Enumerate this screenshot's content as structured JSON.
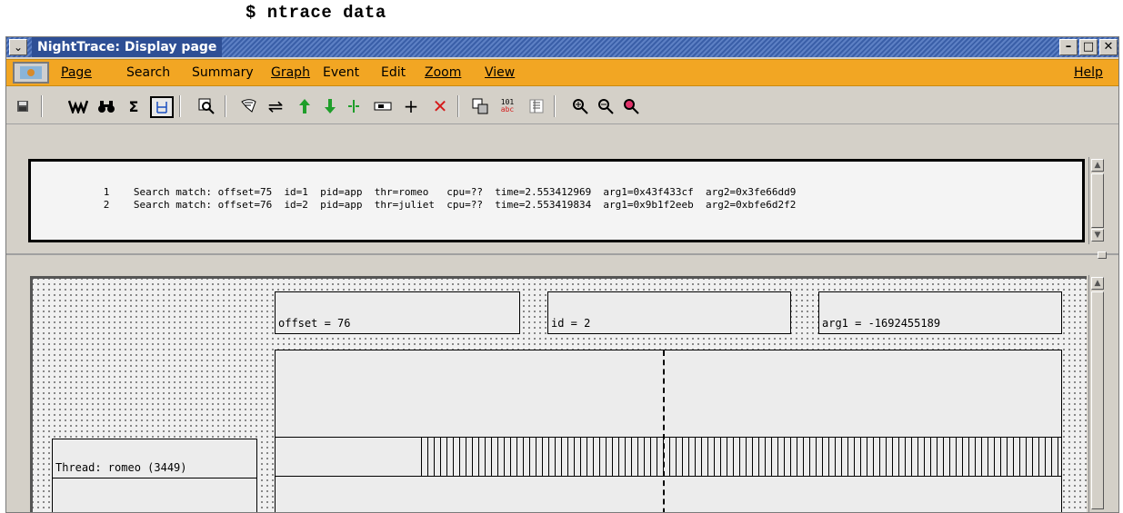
{
  "command": "$ ntrace data",
  "window": {
    "title": "NightTrace: Display page",
    "controls": {
      "minimize": "–",
      "maximize": "□",
      "close": "✕"
    }
  },
  "menu": {
    "items": [
      {
        "id": "page",
        "label": "Page"
      },
      {
        "id": "search",
        "label": "Search"
      },
      {
        "id": "summary",
        "label": "Summary"
      },
      {
        "id": "graph",
        "label": "Graph"
      },
      {
        "id": "event",
        "label": "Event"
      },
      {
        "id": "edit",
        "label": "Edit"
      },
      {
        "id": "zoom",
        "label": "Zoom"
      },
      {
        "id": "view",
        "label": "View"
      }
    ],
    "help": "Help"
  },
  "toolbar": {
    "icons": {
      "save": "save-icon",
      "filter": "filter-icon",
      "search": "binoculars-icon",
      "sigma": "Σ",
      "summary": "summary-icon",
      "inspect": "magnifier-icon",
      "edit": "edit-icon",
      "swap": "⇌",
      "up": "↑",
      "down": "↓",
      "split": "split-icon",
      "tag": "tag-icon",
      "cross": "+",
      "delete": "✕",
      "copy": "copy-icon",
      "binary": "binary-icon",
      "list": "list-icon",
      "zoom_in": "zoom-in-icon",
      "zoom_out": "zoom-out-icon",
      "zoom_reset": "zoom-reset-icon"
    },
    "sigma_text": "Σ",
    "binary_text_top": "101",
    "binary_text_bottom": "abc",
    "colors": {
      "green": "#1f9e2a",
      "red": "#d51a1a"
    }
  },
  "search_results": [
    {
      "index": "1",
      "text": "Search match: offset=75  id=1  pid=app  thr=romeo   cpu=??  time=2.553412969  arg1=0x43f433cf  arg2=0x3fe66dd9"
    },
    {
      "index": "2",
      "text": "Search match: offset=76  id=2  pid=app  thr=juliet  cpu=??  time=2.553419834  arg1=0x9b1f2eeb  arg2=0xbfe6d2f2"
    }
  ],
  "graph": {
    "offset_label": "offset = 76",
    "id_label": "id = 2",
    "arg1_label": "arg1 = -1692455189",
    "thread_label": "Thread: romeo (3449)"
  },
  "colors": {
    "menubar": "#f2a623",
    "titlebar": "#3a5fa8"
  }
}
